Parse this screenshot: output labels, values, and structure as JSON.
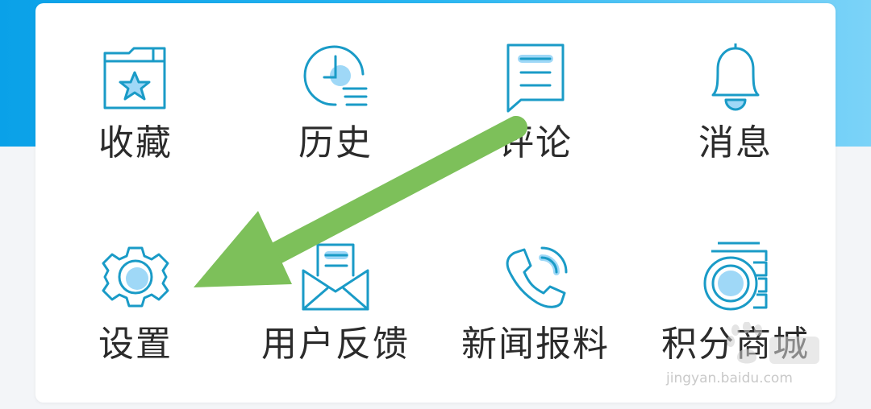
{
  "menu": {
    "items": [
      {
        "label": "收藏",
        "icon": "folder-star-icon"
      },
      {
        "label": "历史",
        "icon": "clock-history-icon"
      },
      {
        "label": "评论",
        "icon": "comment-icon"
      },
      {
        "label": "消息",
        "icon": "bell-icon"
      },
      {
        "label": "设置",
        "icon": "gear-icon"
      },
      {
        "label": "用户反馈",
        "icon": "envelope-icon"
      },
      {
        "label": "新闻报料",
        "icon": "phone-icon"
      },
      {
        "label": "积分商城",
        "icon": "coins-icon"
      }
    ]
  },
  "colors": {
    "header_gradient": [
      "#0aa1e8",
      "#7bd3f8"
    ],
    "icon_stroke": "#1a9bc7",
    "icon_fill": "#9fd8f7",
    "arrow": "#7dc05a"
  },
  "watermark": {
    "brand": "Bai 经验",
    "url": "jingyan.baidu.com"
  }
}
